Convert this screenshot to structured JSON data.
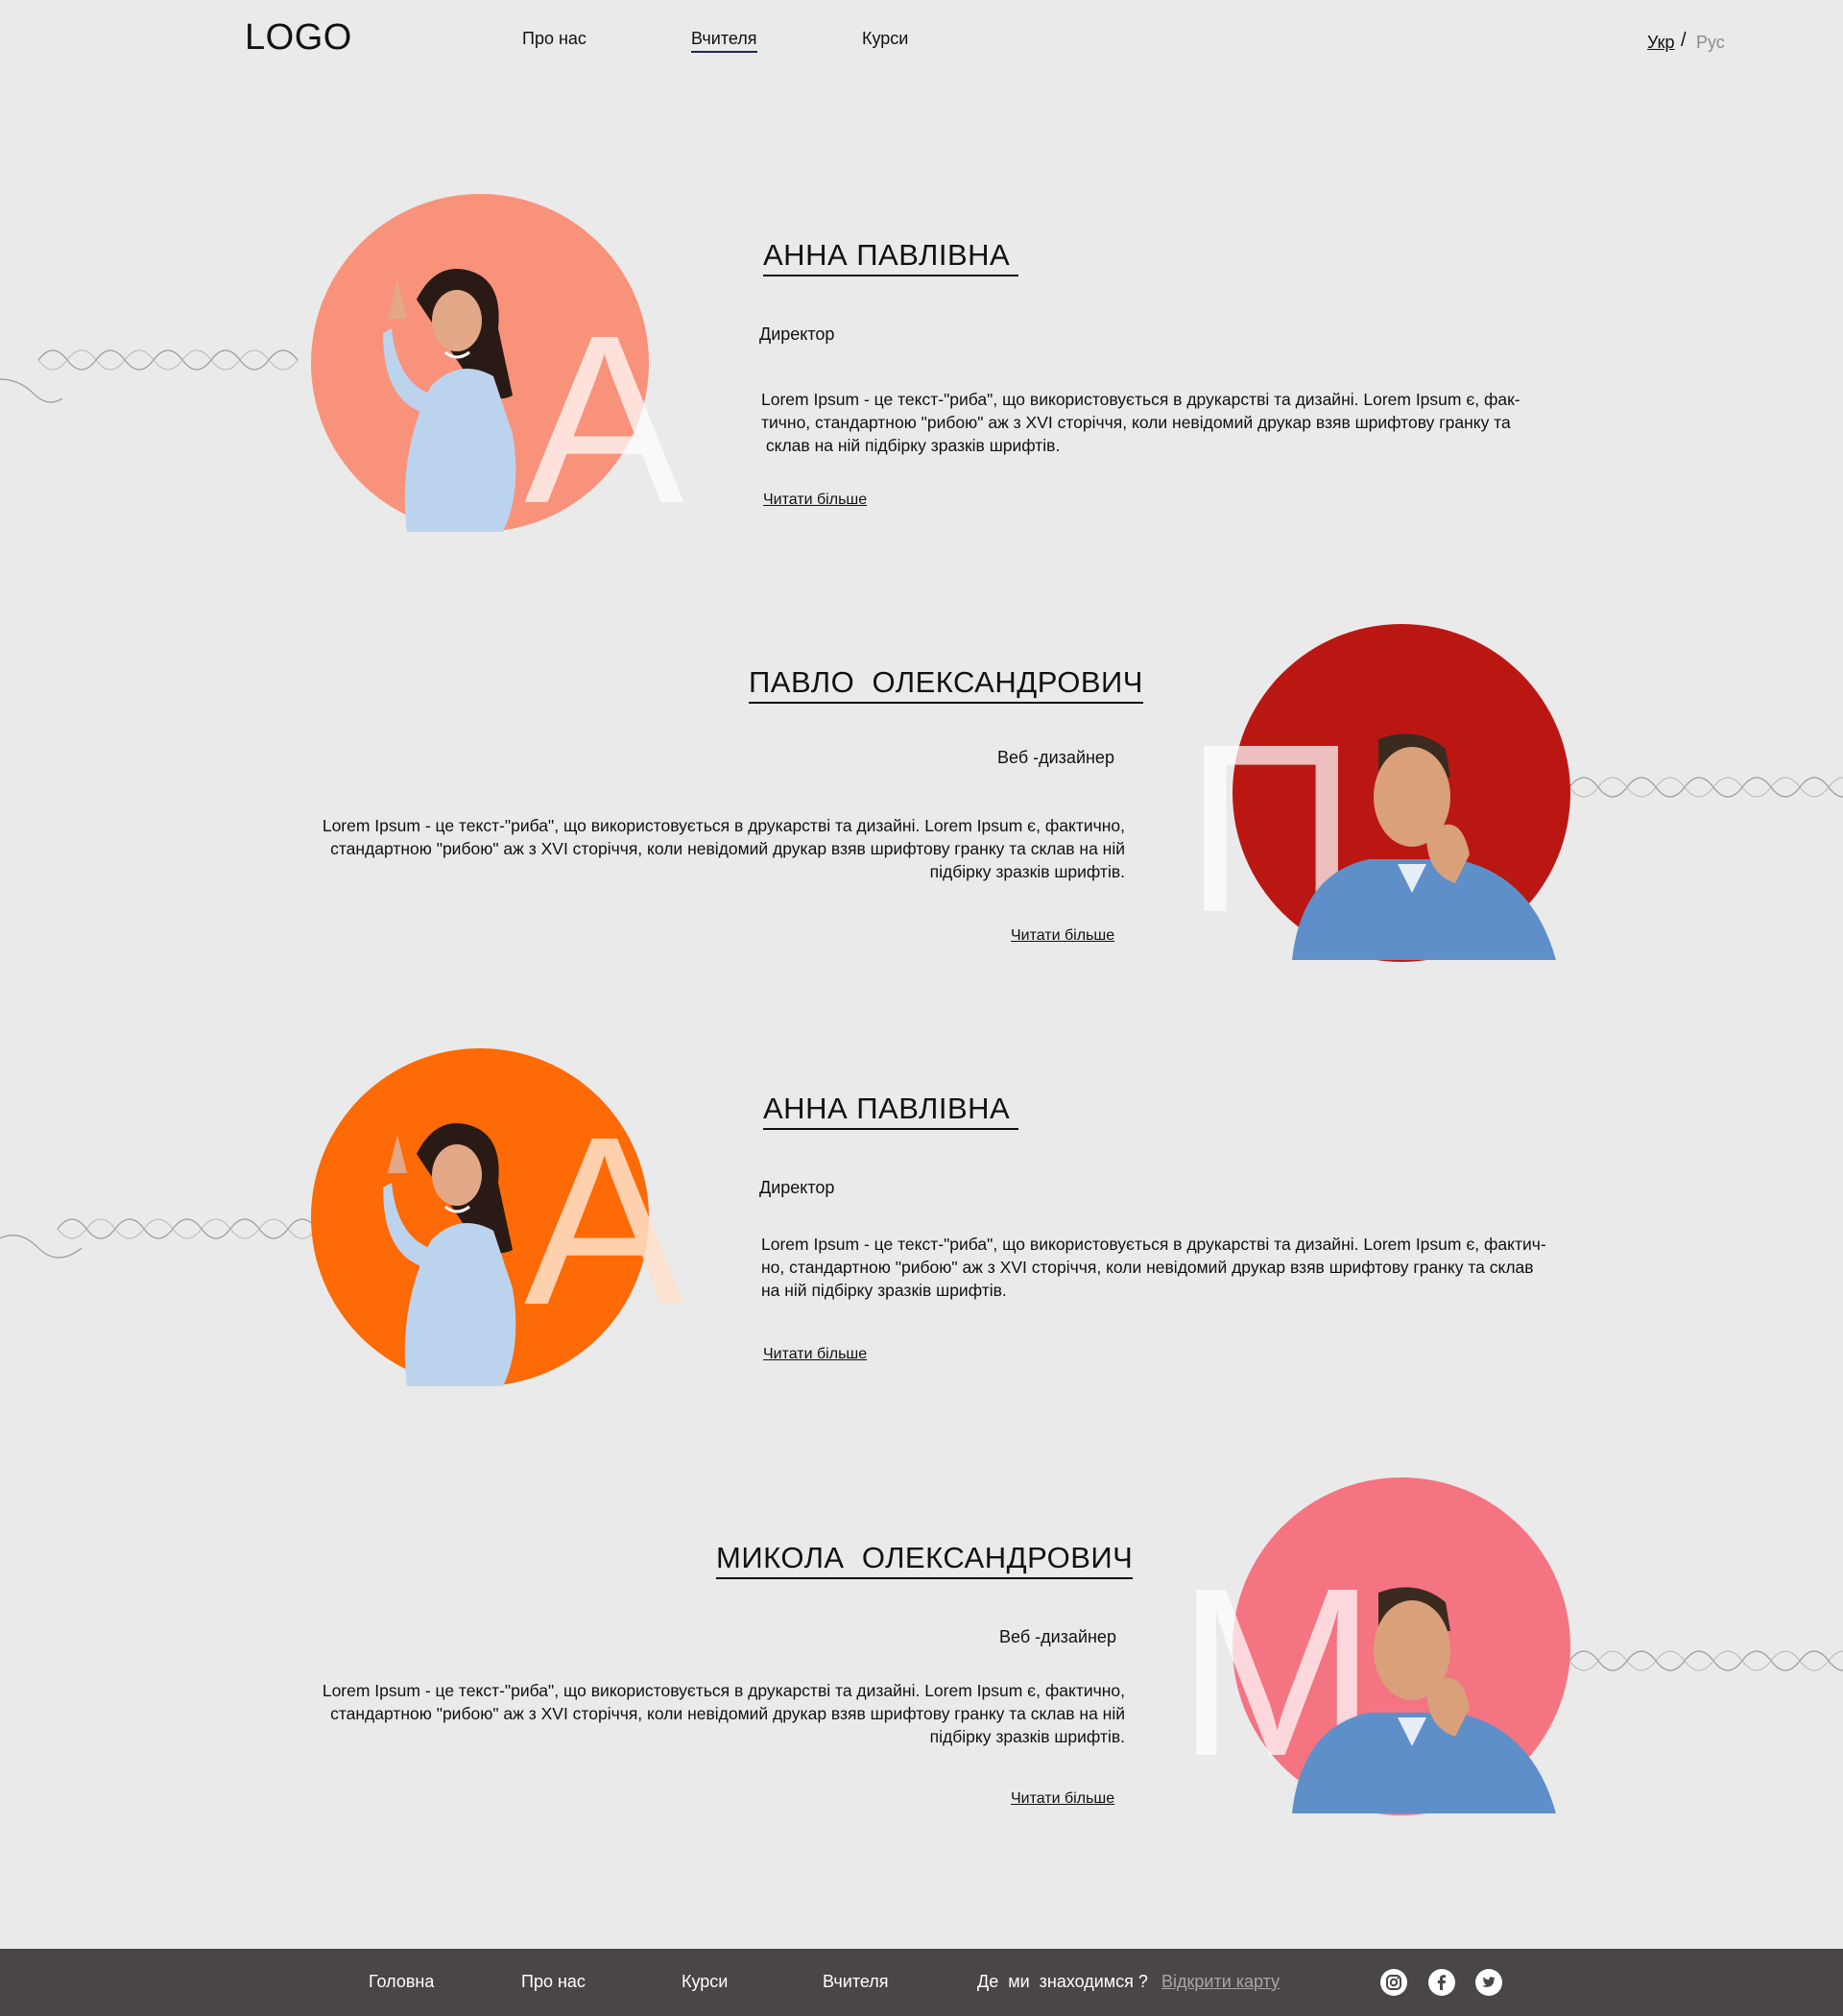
{
  "header": {
    "logo": "LOGO",
    "nav": [
      {
        "label": "Про нас"
      },
      {
        "label": "Вчителя"
      },
      {
        "label": "Курси"
      }
    ],
    "lang_ukr": "Укр",
    "lang_sep": "/",
    "lang_rus": "Рус"
  },
  "teachers": [
    {
      "name": "АННА ПАВЛІВНА ",
      "letter": "А",
      "role": "Директор",
      "description": [
        "Lorem Ipsum - це текст-\"риба\", що використовується в друкарстві та дизайні. Lorem Ipsum є, фак-",
        "тично, стандартною  \"рибою\" аж з XVI сторіччя, коли невідомий друкар взяв шрифтову гранку та",
        " склав на ній підбірку зразків шрифтів."
      ],
      "more": "Читати більше ",
      "color": "#f9927a"
    },
    {
      "name": "ПАВЛО  ОЛЕКСАНДРОВИЧ",
      "letter": "П",
      "role": "Веб -дизайнер",
      "description": [
        "Lorem Ipsum - це текст-\"риба\", що використовується в друкарстві та дизайні. Lorem Ipsum є, фактично,",
        "стандартною \"рибою\" аж з XVI сторіччя, коли невідомий друкар взяв шрифтову гранку та склав на ній",
        "підбірку зразків шрифтів."
      ],
      "more": "Читати більше ",
      "color": "#bb1712"
    },
    {
      "name": "АННА ПАВЛІВНА ",
      "letter": "А",
      "role": "Директор",
      "description": [
        "Lorem Ipsum - це текст-\"риба\", що використовується в друкарстві та дизайні. Lorem Ipsum є, фактич-",
        "но, стандартною  \"рибою\" аж з XVI сторіччя, коли невідомий друкар взяв шрифтову гранку та склав",
        "на ній підбірку зразків шрифтів."
      ],
      "more": "Читати більше ",
      "color": "#fd6a06"
    },
    {
      "name": "МИКОЛА  ОЛЕКСАНДРОВИЧ",
      "letter": "М",
      "role": "Веб -дизайнер",
      "description": [
        "Lorem Ipsum - це текст-\"риба\", що використовується в друкарстві та дизайні. Lorem Ipsum є, фактично,",
        "стандартною \"рибою\" аж з XVI сторіччя, коли невідомий друкар взяв шрифтову гранку та склав на ній",
        "підбірку зразків шрифтів."
      ],
      "more": "Читати більше ",
      "color": "#f47482"
    }
  ],
  "footer": {
    "nav": [
      {
        "label": "Головна"
      },
      {
        "label": "Про нас"
      },
      {
        "label": "Курси"
      },
      {
        "label": "Вчителя"
      }
    ],
    "location_label": "Де  ми  знаходимся ?",
    "map_link": "Відкрити карту",
    "social": [
      "instagram-icon",
      "facebook-icon",
      "twitter-icon"
    ]
  }
}
